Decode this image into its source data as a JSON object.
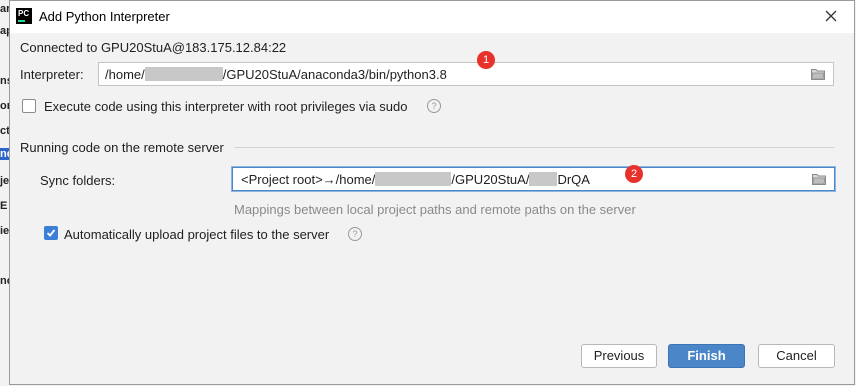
{
  "background_app": {
    "sidebar_fragments": [
      "ar",
      "ap",
      "ns",
      "on",
      "ct",
      "nc",
      "je",
      "E",
      "ie",
      "nc"
    ]
  },
  "dialog": {
    "title": "Add Python Interpreter",
    "connection_text": "Connected to GPU20StuA@183.175.12.84:22",
    "interpreter": {
      "label": "Interpreter:",
      "value_prefix": "/home/",
      "value_suffix": "/GPU20StuA/anaconda3/bin/python3.8",
      "badge": "1"
    },
    "root_privileges": {
      "label": "Execute code using this interpreter with root privileges via sudo",
      "checked": false
    },
    "section_title": "Running code on the remote server",
    "sync_folders": {
      "label": "Sync folders:",
      "value_prefix": "<Project root>→/home/",
      "value_middle": "/GPU20StuA/",
      "value_suffix": "DrQA",
      "badge": "2",
      "hint": "Mappings between local project paths and remote paths on the server"
    },
    "auto_upload": {
      "label": "Automatically upload project files to the server",
      "checked": true
    },
    "buttons": {
      "previous": "Previous",
      "finish": "Finish",
      "cancel": "Cancel"
    },
    "icons": {
      "logo": "pycharm-logo",
      "close": "close-icon",
      "folder": "folder-icon",
      "help": "help-icon"
    },
    "colors": {
      "accent": "#4a86c8",
      "badge": "#e8312b",
      "checkbox_checked": "#3d7fd6"
    }
  }
}
